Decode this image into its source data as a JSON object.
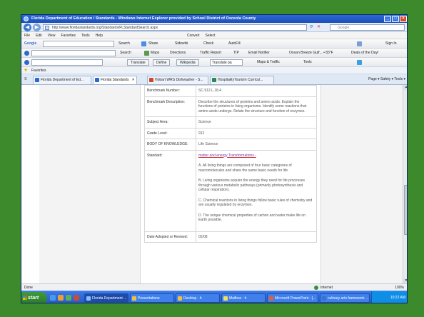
{
  "browser": {
    "window_title": "Florida Department of Education / Standards - Windows Internet Explorer provided by School District of Osceola County",
    "url": "http://www.floridastandards.org/Standards/FLStandardSearch.aspx",
    "search_placeholder": "Google",
    "menu": [
      "File",
      "Edit",
      "View",
      "Favorites",
      "Tools",
      "Help"
    ],
    "convert_label": "Convert",
    "select_label": "Select",
    "toolbar1": {
      "google_label": "Google",
      "search_label": "Search",
      "share_label": "Share",
      "sidewiki_label": "Sidewiki",
      "check_label": "Check",
      "autofill_label": "AutoFill",
      "signin_label": "Sign In"
    },
    "toolbar2": {
      "search_label": "Search",
      "maps_label": "Maps",
      "directions_label": "Directions",
      "traffic_label": "Traffic Report",
      "tip_label": "TIP",
      "email_label": "Email Notifier",
      "weather_label": "Ocean Breeze Gulf... • 83°F",
      "deals_label": "Deals of the Day!"
    },
    "toolbar3": {
      "translate_label": "Translate",
      "define_label": "Define",
      "wikipedia_label": "Wikipedia",
      "translate_select": "Translate pa",
      "maps_traffic_label": "Maps & Traffic",
      "tools_label": "Tools"
    },
    "favorites_label": "Favorites",
    "tabs": [
      "Florida Department of Ed...",
      "Florida Standards",
      "Hobart WRS Dishwasher - S...",
      "HospitalityTourism Curricul..."
    ],
    "tab_tools": "Page ▾  Safety ▾  Tools ▾",
    "status_left": "Done",
    "status_zone": "Internet",
    "status_zoom": "100%"
  },
  "benchmark": {
    "rows": [
      {
        "key": "Benchmark Number:",
        "value": "SC.912.L.18.4"
      },
      {
        "key": "Benchmark Description:",
        "value_parts": [
          "Describe the structures of proteins and amino acids. Explain the functions of proteins in living organisms. Identify some reactions that amino acids undergo. Relate the structure and function of enzymes."
        ]
      },
      {
        "key": "Subject Area:",
        "value": "Science"
      },
      {
        "key": "Grade Level:",
        "value": "912"
      },
      {
        "key": "BODY OF KNOWLEDGE:",
        "value": "Life Science"
      },
      {
        "key": "Standard:",
        "value": "matter and energy Transformations -"
      },
      {
        "key": "Date Adopted or Revised:",
        "value": "02/08"
      }
    ],
    "standard_paragraphs": [
      "A. All living things are composed of four basic categories of macromolecules and share the same basic needs for life.",
      "B. Living organisms acquire the energy they need for life processes through various metabolic pathways (primarily photosynthesis and cellular respiration).",
      "C. Chemical reactions in living things follow basic rules of chemistry and are usually regulated by enzymes.",
      "D. The unique chemical properties of carbon and water make life on Earth possible."
    ]
  },
  "taskbar": {
    "start_label": "start",
    "items": [
      "Florida Department ...",
      "Presentations",
      "Desktop - h",
      "Mailbox - h",
      "Microsoft PowerPoint - [...",
      "culinary arts framework ..."
    ],
    "clock": "10:22 AM"
  }
}
